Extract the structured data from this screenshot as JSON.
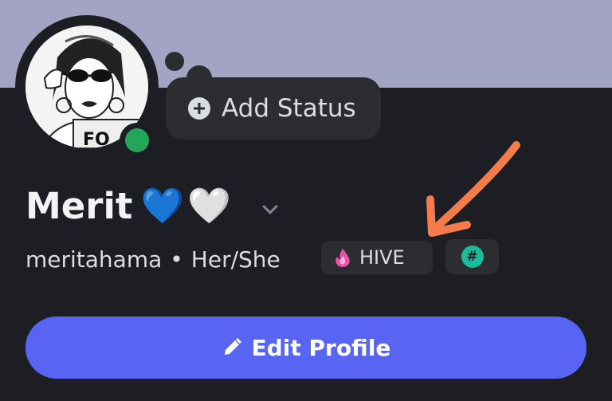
{
  "profile": {
    "display_name": "Merit",
    "name_emojis": [
      "💙",
      "🤍"
    ],
    "username": "meritahama",
    "separator": "•",
    "pronouns": "Her/She",
    "online_status_color": "#23a55a"
  },
  "status": {
    "add_status_label": "Add Status",
    "icon": "plus-circle-icon"
  },
  "badges": [
    {
      "icon": "pink-flame-icon",
      "label": "HIVE"
    },
    {
      "icon": "hashtag-icon",
      "label": "#"
    }
  ],
  "actions": {
    "edit_profile_label": "Edit Profile",
    "edit_icon": "pencil-icon"
  },
  "avatar": {
    "text": "FO"
  },
  "colors": {
    "banner": "#a3a3c4",
    "background": "#1d1e23",
    "surface": "#2b2d31",
    "accent": "#5865f2",
    "annotation_arrow": "#f47c4b",
    "hash_badge": "#1abc9c"
  }
}
